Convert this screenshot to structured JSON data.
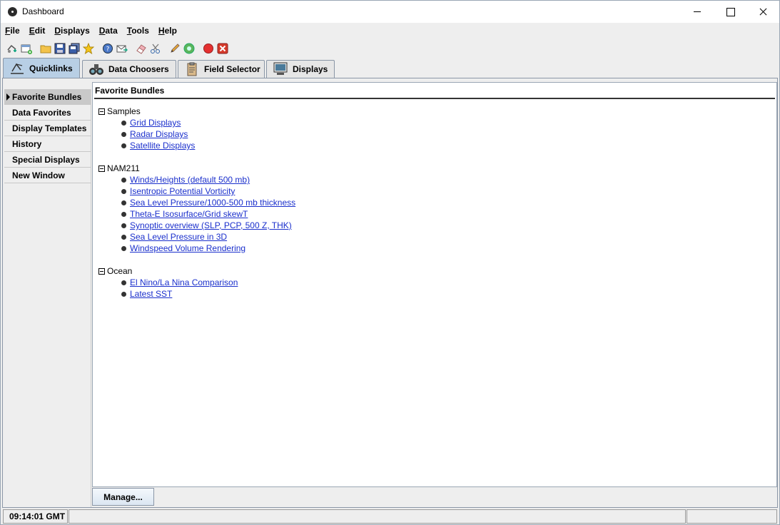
{
  "window": {
    "title": "Dashboard"
  },
  "menu": [
    "File",
    "Edit",
    "Displays",
    "Data",
    "Tools",
    "Help"
  ],
  "toolbar_icons": [
    "new-display-icon",
    "new-window-icon",
    "open-folder-icon",
    "save-icon",
    "save-all-icon",
    "favorite-star-icon",
    "help-icon",
    "send-mail-icon",
    "eraser-icon",
    "cut-icon",
    "pencil-icon",
    "refresh-globe-icon",
    "record-stop-icon",
    "remove-all-icon"
  ],
  "tabs": [
    {
      "label": "Quicklinks",
      "icon": "quicklinks-icon",
      "active": true
    },
    {
      "label": "Data Choosers",
      "icon": "binoculars-icon",
      "active": false
    },
    {
      "label": "Field Selector",
      "icon": "clipboard-icon",
      "active": false
    },
    {
      "label": "Displays",
      "icon": "monitor-icon",
      "active": false
    }
  ],
  "sidebar": [
    {
      "label": "Favorite Bundles",
      "active": true
    },
    {
      "label": "Data Favorites",
      "active": false
    },
    {
      "label": "Display Templates",
      "active": false
    },
    {
      "label": "History",
      "active": false
    },
    {
      "label": "Special Displays",
      "active": false
    },
    {
      "label": "New Window",
      "active": false
    }
  ],
  "panel": {
    "title": "Favorite Bundles",
    "groups": [
      {
        "name": "Samples",
        "links": [
          "Grid Displays",
          "Radar Displays",
          "Satellite Displays"
        ]
      },
      {
        "name": "NAM211",
        "links": [
          "Winds/Heights (default 500 mb)",
          "Isentropic Potential Vorticity",
          "Sea Level Pressure/1000-500 mb thickness",
          "Theta-E Isosurface/Grid skewT",
          "Synoptic overview (SLP, PCP, 500 Z, THK)",
          "Sea Level Pressure in 3D",
          "Windspeed Volume Rendering"
        ]
      },
      {
        "name": "Ocean",
        "links": [
          "El Nino/La Nina Comparison",
          "Latest SST"
        ]
      }
    ]
  },
  "manage_button": "Manage...",
  "status": {
    "time": "09:14:01 GMT",
    "message": "",
    "extra": ""
  }
}
